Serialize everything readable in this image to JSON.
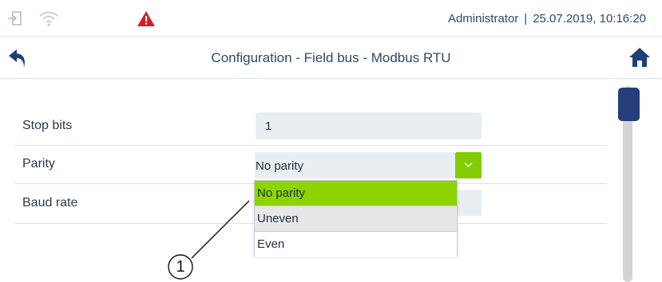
{
  "status_bar": {
    "user": "Administrator",
    "separator": "|",
    "datetime": "25.07.2019, 10:16:20",
    "icons": [
      "login-icon",
      "wifi-icon",
      "warning-icon"
    ],
    "warning_color": "#d81e1e"
  },
  "header": {
    "title": "Configuration - Field bus - Modbus RTU",
    "back_icon": "back-arrow-icon",
    "home_icon": "home-icon",
    "icon_color": "#1f3f78"
  },
  "form": {
    "stop_bits": {
      "label": "Stop bits",
      "value": "1"
    },
    "parity": {
      "label": "Parity",
      "value": "No parity"
    },
    "baud_rate": {
      "label": "Baud rate"
    }
  },
  "dropdown": {
    "options": [
      "No parity",
      "Uneven",
      "Even"
    ],
    "selected": "No parity",
    "accent_color": "#8ed400"
  },
  "callout": {
    "number": "1"
  }
}
